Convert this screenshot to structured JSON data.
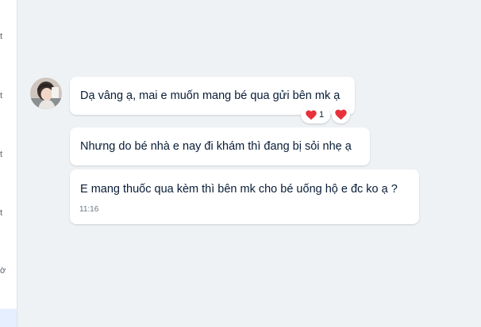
{
  "sidebar": {
    "cut_labels": [
      "t",
      "t",
      "t",
      "t",
      "ờ"
    ]
  },
  "conversation": {
    "messages": [
      {
        "text": "Dạ vâng ạ, mai e muốn mang bé qua gửi bên mk ạ"
      },
      {
        "text": "Nhưng do bé nhà e nay đi khám thì đang bị sỏi nhẹ ạ"
      },
      {
        "text": "E mang thuốc qua kèm thì bên mk cho bé uống hộ e đc ko ạ ?",
        "time": "11:16"
      }
    ],
    "reaction": {
      "icon": "heart-icon",
      "count": "1",
      "color": "#e8303a"
    }
  },
  "colors": {
    "background": "#eff2f5",
    "bubble": "#ffffff",
    "text": "#081c36",
    "heart": "#e8303a"
  }
}
